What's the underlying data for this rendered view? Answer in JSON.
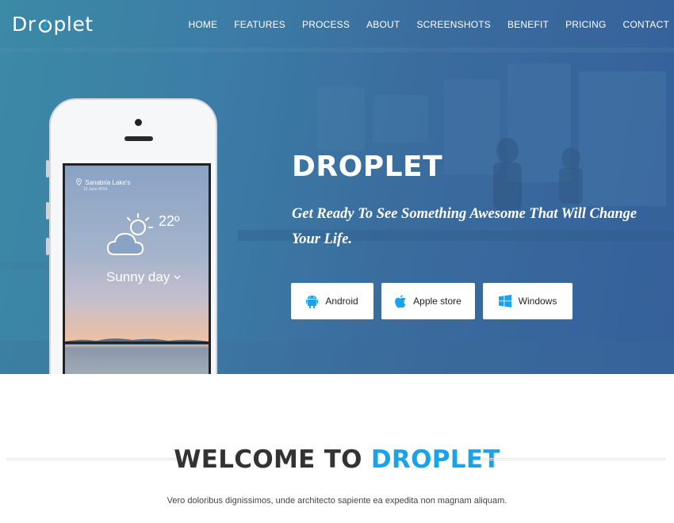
{
  "brand": {
    "logo_text_pre": "Dr",
    "logo_text_post": "plet"
  },
  "nav": {
    "items": [
      {
        "label": "HOME"
      },
      {
        "label": "FEATURES"
      },
      {
        "label": "PROCESS"
      },
      {
        "label": "ABOUT"
      },
      {
        "label": "SCREENSHOTS"
      },
      {
        "label": "BENEFIT"
      },
      {
        "label": "PRICING"
      },
      {
        "label": "CONTACT"
      }
    ]
  },
  "phone": {
    "location": "Sanabria Lake's",
    "date": "12 June 2014",
    "temperature": "22º",
    "condition": "Sunny day"
  },
  "hero": {
    "title": "DROPLET",
    "tagline": "Get Ready To See Something Awesome That Will Change Your Life.",
    "buttons": {
      "android": "Android",
      "apple": "Apple store",
      "windows": "Windows"
    }
  },
  "welcome": {
    "title_main": "WELCOME TO ",
    "title_accent": "DROPLET",
    "subtitle": "Vero doloribus dignissimos, unde architecto sapiente ea expedita non magnam aliquam."
  },
  "colors": {
    "accent": "#1aa3e8",
    "hero_gradient_start": "#3b8aa6",
    "hero_gradient_end": "#35609a",
    "heading_text": "#333333"
  },
  "icons": [
    "droplet-logo-icon",
    "location-pin-icon",
    "sun-cloud-icon",
    "chevron-down-icon",
    "android-icon",
    "apple-icon",
    "windows-icon"
  ]
}
